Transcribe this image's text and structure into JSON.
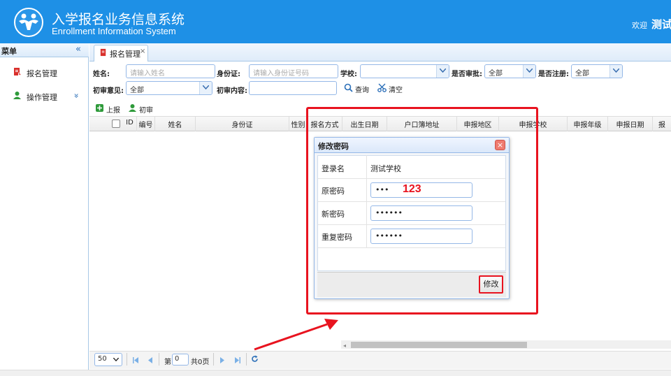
{
  "app": {
    "title_cn": "入学报名业务信息系统",
    "title_en": "Enrollment Information System",
    "welcome": "欢迎",
    "username": "测试"
  },
  "sidebar": {
    "header": "菜单",
    "collapse_icon": "«",
    "items": [
      {
        "label": "报名管理",
        "icon": "document-icon",
        "color": "#d9302c"
      },
      {
        "label": "操作管理",
        "icon": "user-icon",
        "color": "#2e9a3a",
        "expand_icon": "»"
      }
    ]
  },
  "tabs": [
    {
      "label": "报名管理",
      "close": "×"
    }
  ],
  "filters": {
    "name_label": "姓名:",
    "name_placeholder": "请输入姓名",
    "id_label": "身份证:",
    "id_placeholder": "请输入身份证号码",
    "school_label": "学校:",
    "school_value": "",
    "approved_label": "是否审批:",
    "approved_value": "全部",
    "registered_label": "是否注册:",
    "registered_value": "全部",
    "first_opinion_label": "初审意见:",
    "first_opinion_value": "全部",
    "first_content_label": "初审内容:",
    "first_content_value": "",
    "search_label": "查询",
    "clear_label": "清空"
  },
  "toolbar": {
    "report_label": "上报",
    "first_review_label": "初审"
  },
  "grid": {
    "columns": [
      "ID",
      "编号",
      "姓名",
      "身份证",
      "性别",
      "报名方式",
      "出生日期",
      "户口簿地址",
      "申报地区",
      "申报学校",
      "申报年级",
      "申报日期",
      "报"
    ]
  },
  "pager": {
    "page_size": "50",
    "page_prefix": "第",
    "page_value": "0",
    "page_total": "共0页"
  },
  "dialog": {
    "title": "修改密码",
    "close": "×",
    "login_label": "登录名",
    "login_value": "测试学校",
    "old_pwd_label": "原密码",
    "old_pwd_mask": "•••",
    "new_pwd_label": "新密码",
    "new_pwd_mask": "••••••",
    "repeat_pwd_label": "重复密码",
    "repeat_pwd_mask": "••••••",
    "submit_label": "修改"
  },
  "annotation": {
    "note": "123",
    "color": "#e8131f"
  }
}
